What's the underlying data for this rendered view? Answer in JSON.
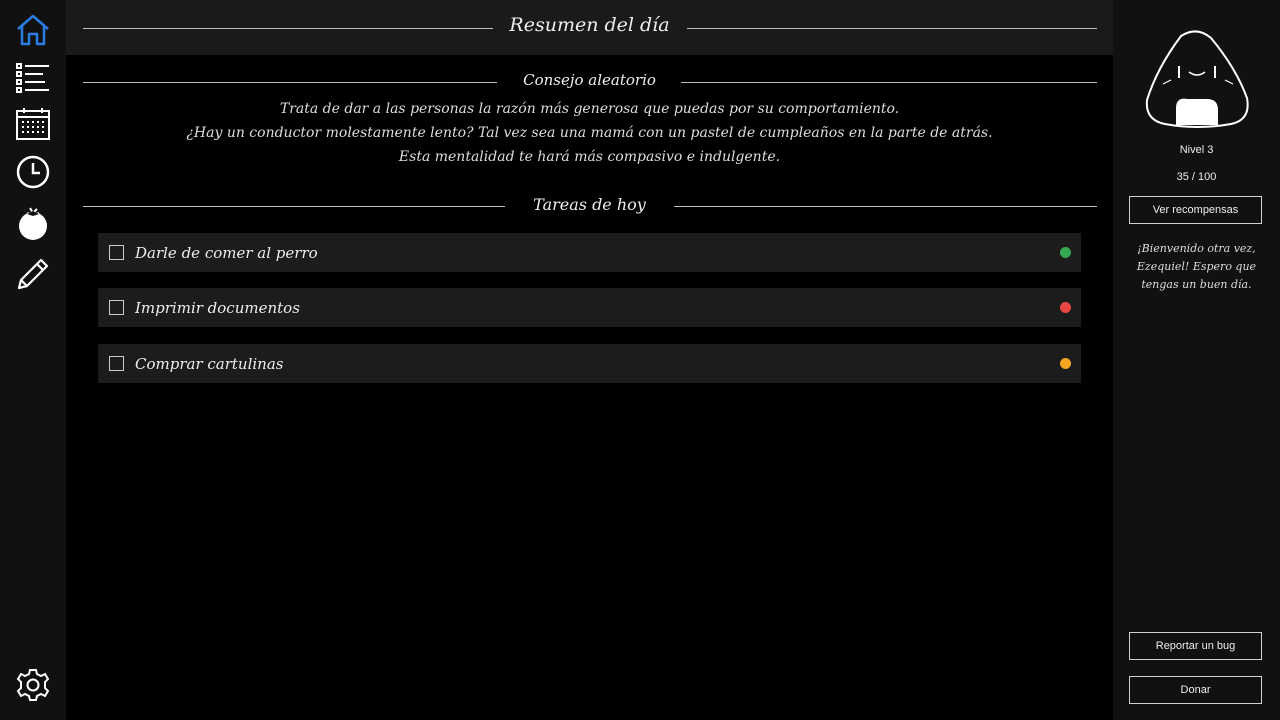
{
  "nav": {
    "items": [
      {
        "icon": "home-icon",
        "active": true
      },
      {
        "icon": "list-icon"
      },
      {
        "icon": "calendar-icon"
      },
      {
        "icon": "clock-icon"
      },
      {
        "icon": "tomato-icon"
      },
      {
        "icon": "pencil-icon"
      }
    ],
    "settings_icon": "gear-icon",
    "active_color": "#2a7de1"
  },
  "header": {
    "title": "Resumen del día"
  },
  "advice": {
    "heading": "Consejo aleatorio",
    "lines": [
      "Trata de dar a las personas la razón más generosa que puedas por su comportamiento.",
      "¿Hay un conductor molestamente lento? Tal vez sea una mamá con un pastel de cumpleaños en la parte de atrás.",
      "Esta mentalidad te hará más compasivo e indulgente."
    ]
  },
  "tasks": {
    "heading": "Tareas de hoy",
    "items": [
      {
        "label": "Darle de comer al perro",
        "checked": false,
        "priority_color": "#34a853"
      },
      {
        "label": "Imprimir documentos",
        "checked": false,
        "priority_color": "#e84545"
      },
      {
        "label": "Comprar cartulinas",
        "checked": false,
        "priority_color": "#f5a623"
      }
    ]
  },
  "profile": {
    "level": "Nivel 3",
    "xp": "35 / 100",
    "rewards_button": "Ver recompensas",
    "welcome": "¡Bienvenido otra vez, Ezequiel! Espero que tengas un buen día.",
    "report_button": "Reportar un bug",
    "donate_button": "Donar"
  }
}
